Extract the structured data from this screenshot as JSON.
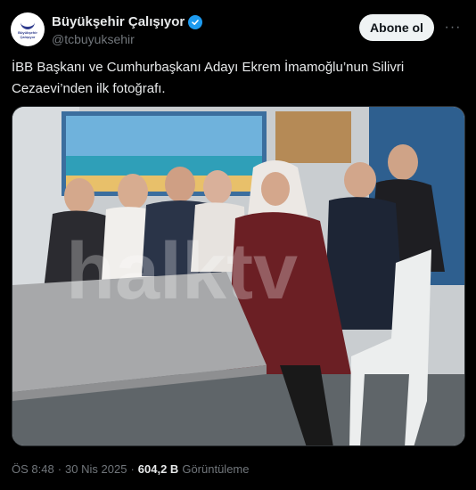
{
  "header": {
    "display_name": "Büyükşehir Çalışıyor",
    "handle": "@tcbuyuksehir",
    "follow_label": "Abone ol",
    "more_label": "···",
    "avatar_text": "Büyükşehir Çalışıyor"
  },
  "tweet": {
    "text": "İBB Başkanı ve Cumhurbaşkanı Adayı Ekrem İmamoğlu’nun Silivri Cezaevi’nden ilk fotoğrafı."
  },
  "media": {
    "watermark": "halktv"
  },
  "meta": {
    "time": "ÖS 8:48",
    "separator1": "·",
    "date": "30 Nis 2025",
    "separator2": "·",
    "views_count": "604,2 B",
    "views_label": "Görüntüleme"
  },
  "colors": {
    "background": "#000000",
    "text": "#e7e9ea",
    "muted": "#71767b",
    "verified": "#1d9bf0",
    "button_bg": "#eff3f4"
  }
}
